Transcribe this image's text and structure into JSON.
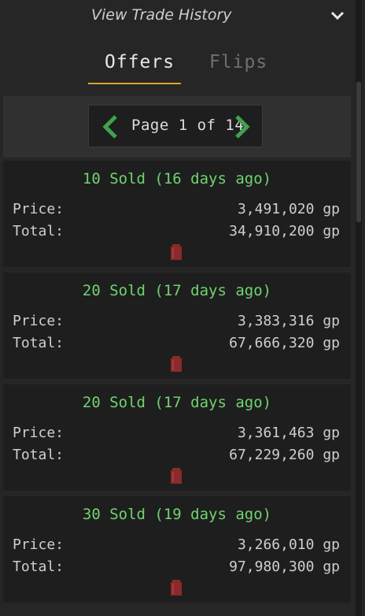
{
  "header": {
    "title": "View Trade History",
    "chevron_icon": "chevron-down-icon"
  },
  "tabs": [
    {
      "label": "Offers",
      "active": true
    },
    {
      "label": "Flips",
      "active": false
    }
  ],
  "pager": {
    "label": "Page 1 of 14",
    "prev_icon": "chevron-left-icon",
    "next_icon": "chevron-right-icon"
  },
  "labels": {
    "price": "Price:",
    "total": "Total:"
  },
  "trades": [
    {
      "title": "10 Sold (16 days ago)",
      "price": "3,491,020 gp",
      "total": "34,910,200 gp"
    },
    {
      "title": "20 Sold (17 days ago)",
      "price": "3,383,316 gp",
      "total": "67,666,320 gp"
    },
    {
      "title": "20 Sold (17 days ago)",
      "price": "3,361,463 gp",
      "total": "67,229,260 gp"
    },
    {
      "title": "30 Sold (19 days ago)",
      "price": "3,266,010 gp",
      "total": "97,980,300 gp"
    }
  ],
  "colors": {
    "accent": "#d9a628",
    "sold_green": "#6fd46f",
    "arrow_green": "#3fa34d",
    "trash_red": "#8b2a2a"
  }
}
